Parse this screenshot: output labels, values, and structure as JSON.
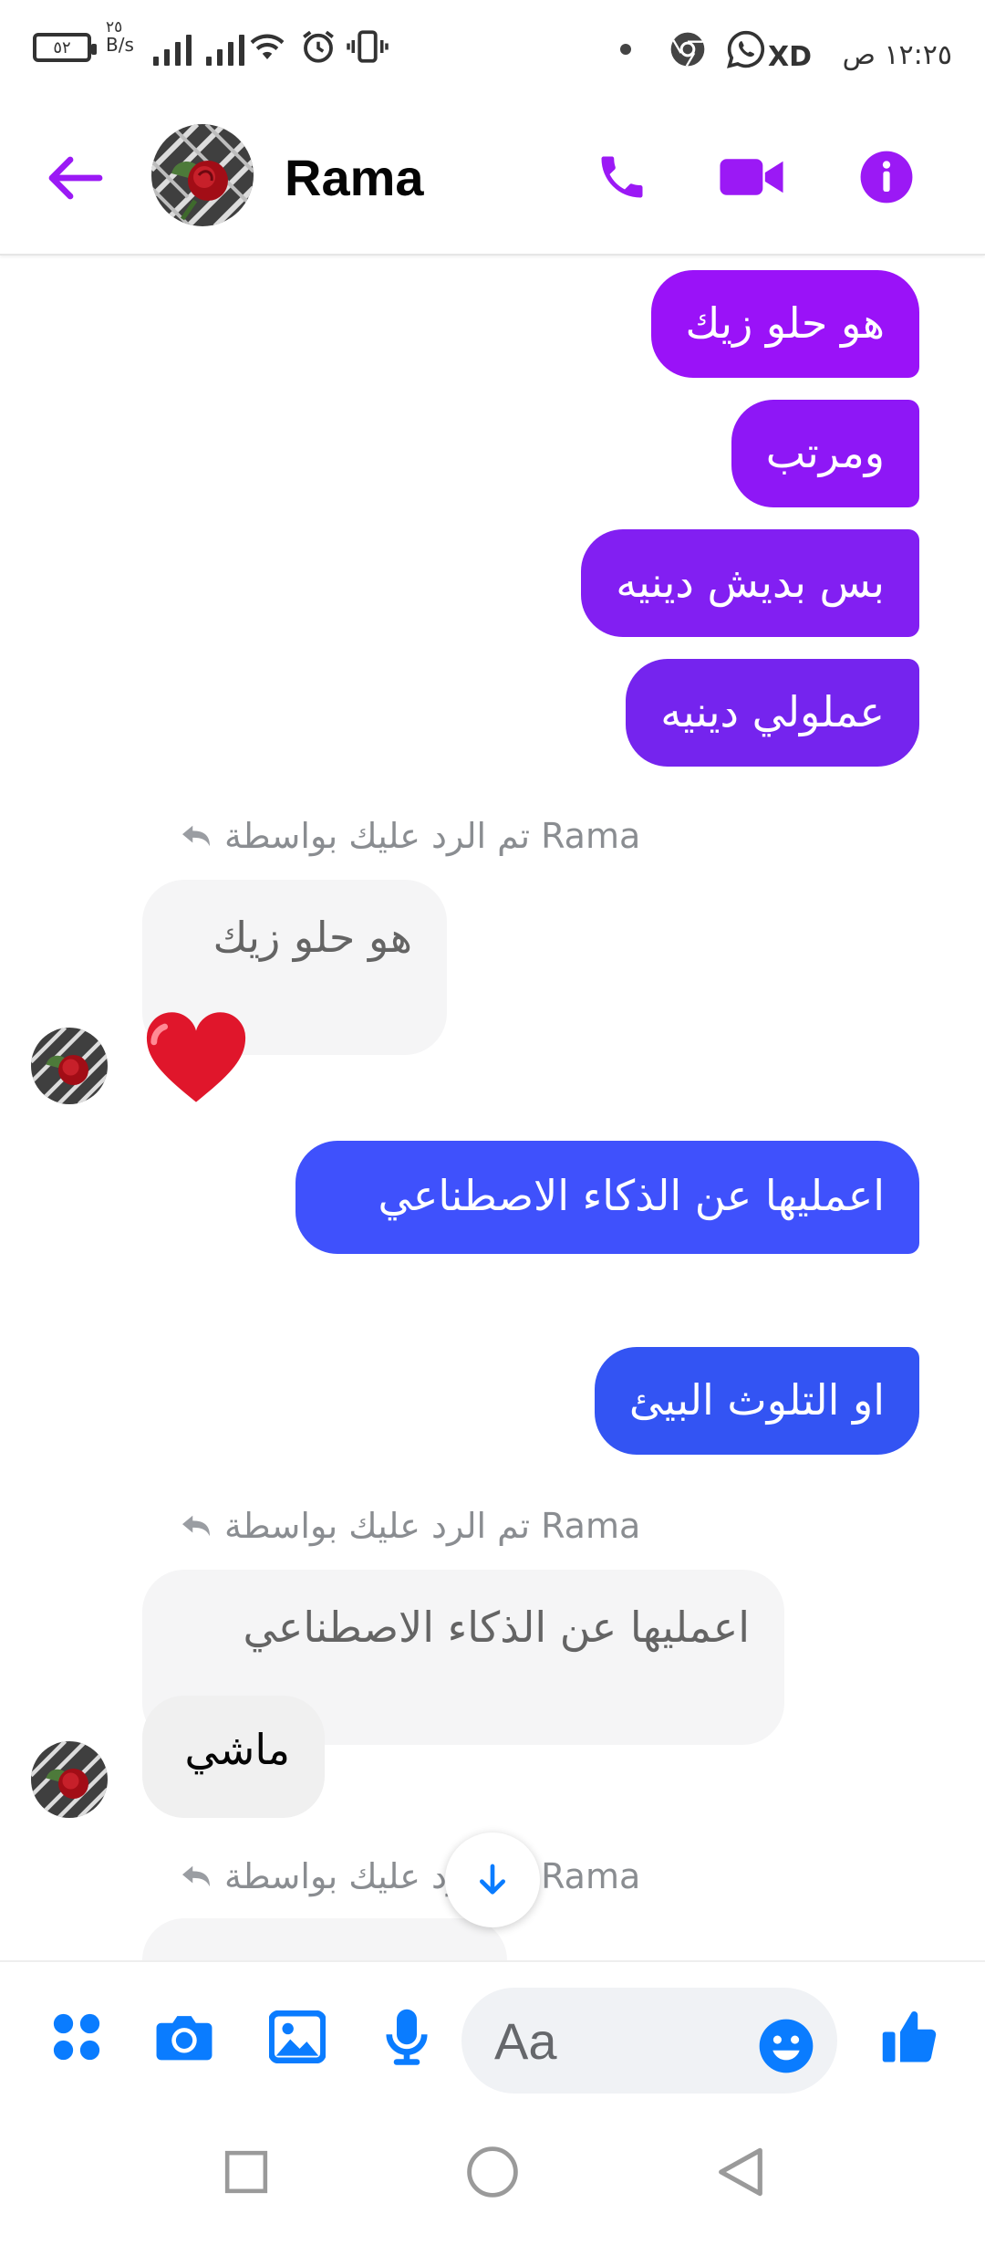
{
  "status_bar": {
    "battery": "٥٢",
    "speed_value": "٢٥",
    "speed_unit": "B/s",
    "xd": "XD",
    "time": "١٢:٢٥ ص"
  },
  "header": {
    "contact_name": "Rama",
    "accent": "#9b19f5"
  },
  "messages_out_top": [
    {
      "text": "هو حلو زيك",
      "color": "#9a12f8"
    },
    {
      "text": "ومرتب",
      "color": "#8e17f6"
    },
    {
      "text": "بس بديش دينيه",
      "color": "#821ff2"
    },
    {
      "text": "عملولي دينيه",
      "color": "#7524ee"
    }
  ],
  "reply_notice_1": "Rama تم الرد عليك بواسطة",
  "quoted_1": "هو حلو زيك",
  "reaction_1": "heart-emoji",
  "messages_out_mid": [
    {
      "text": "اعمليها عن الذكاء الاصطناعي",
      "color": "#3f51fc"
    },
    {
      "text": "او التلوث البيئ",
      "color": "#3354f3"
    }
  ],
  "reply_notice_2": "Rama تم الرد عليك بواسطة",
  "quoted_2": "اعمليها عن الذكاء الاصطناعي",
  "reply_2": "ماشي",
  "reply_notice_3": "Rama تم الرد عليك بواسطة",
  "composer": {
    "placeholder": "Aa",
    "accent": "#0a7cff"
  }
}
